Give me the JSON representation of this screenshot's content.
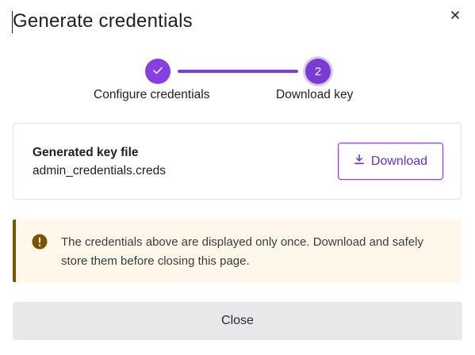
{
  "dialog": {
    "title": "Generate credentials"
  },
  "stepper": {
    "steps": [
      {
        "label": "Configure credentials",
        "state": "completed",
        "marker": "✓"
      },
      {
        "label": "Download key",
        "state": "current",
        "marker": "2"
      }
    ],
    "accent_color": "#7a3bd3"
  },
  "key_file": {
    "title": "Generated key file",
    "filename": "admin_credentials.creds",
    "download_label": "Download"
  },
  "warning": {
    "message": "The credentials above are displayed only once. Download and safely store them before closing this page.",
    "icon": "exclamation-circle-icon",
    "color": "#7a5400"
  },
  "footer": {
    "close_label": "Close"
  }
}
